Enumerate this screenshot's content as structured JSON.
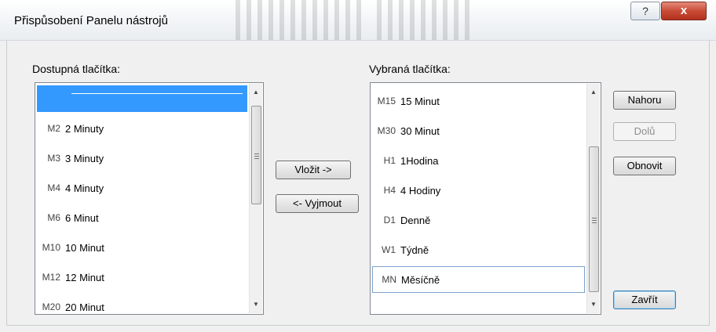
{
  "window": {
    "title": "Přispůsobení Panelu nástrojů",
    "help_label": "?",
    "close_label": "x"
  },
  "available": {
    "label": "Dostupná tlačítka:",
    "items": [
      {
        "code": "",
        "label": "",
        "separator": true,
        "selected": true
      },
      {
        "code": "M2",
        "label": "2 Minuty"
      },
      {
        "code": "M3",
        "label": "3 Minuty"
      },
      {
        "code": "M4",
        "label": "4 Minuty"
      },
      {
        "code": "M6",
        "label": "6 Minut"
      },
      {
        "code": "M10",
        "label": "10 Minut"
      },
      {
        "code": "M12",
        "label": "12 Minut"
      },
      {
        "code": "M20",
        "label": "20 Minut"
      }
    ]
  },
  "selected": {
    "label": "Vybraná tlačítka:",
    "items": [
      {
        "code": "M15",
        "label": "15 Minut"
      },
      {
        "code": "M30",
        "label": "30 Minut"
      },
      {
        "code": "H1",
        "label": "1Hodina"
      },
      {
        "code": "H4",
        "label": "4 Hodiny"
      },
      {
        "code": "D1",
        "label": "Denně"
      },
      {
        "code": "W1",
        "label": "Týdně"
      },
      {
        "code": "MN",
        "label": "Měsíčně",
        "focused": true
      }
    ]
  },
  "buttons": {
    "insert": "Vložit ->",
    "remove": "<- Vyjmout",
    "up": "Nahoru",
    "down": "Dolů",
    "reset": "Obnovit",
    "close": "Zavřít"
  },
  "scroll": {
    "up_arrow": "▲",
    "down_arrow": "▼"
  }
}
